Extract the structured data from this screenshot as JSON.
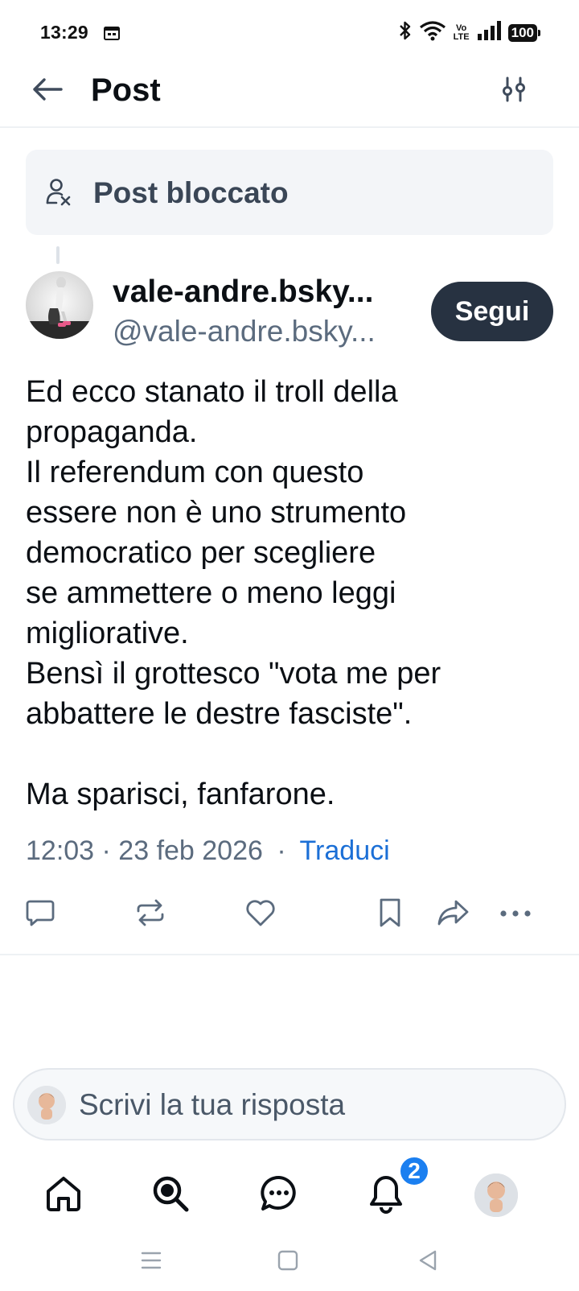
{
  "status_bar": {
    "time": "13:29",
    "network_label": "Vo\nLTE",
    "battery": "100",
    "icons": [
      "calendar-icon",
      "bluetooth-icon",
      "wifi-icon",
      "volte-icon",
      "signal-icon",
      "battery-icon"
    ]
  },
  "header": {
    "title": "Post",
    "back_icon": "arrow-left-icon",
    "settings_icon": "sliders-icon"
  },
  "blocked_post": {
    "label": "Post bloccato",
    "icon": "person-x-icon"
  },
  "post": {
    "author_name": "vale-andre.bsky...",
    "author_handle": "@vale-andre.bsky...",
    "follow_label": "Segui",
    "text": "Ed ecco stanato il troll della\npropaganda.\nIl referendum con questo\nessere non è uno strumento\ndemocratico per scegliere\nse ammettere o meno leggi\nmigliorative.\nBensì il grottesco \"vota me per\nabbattere le destre fasciste\".\n\nMa sparisci, fanfarone.",
    "timestamp": "12:03 · 23 feb 2026",
    "separator": "·",
    "translate_label": "Traduci"
  },
  "actions": [
    "reply-icon",
    "repost-icon",
    "like-icon",
    "bookmark-icon",
    "share-icon",
    "more-icon"
  ],
  "reply_box": {
    "placeholder": "Scrivi la tua risposta"
  },
  "bottom_nav": {
    "items": [
      "home-icon",
      "search-icon",
      "chat-icon",
      "notifications-icon",
      "profile-avatar"
    ],
    "notification_count": "2"
  },
  "colors": {
    "accent": "#1b6fd6",
    "follow_button": "#273241",
    "badge": "#1b7ff0",
    "secondary_text": "#5b6b7e"
  }
}
